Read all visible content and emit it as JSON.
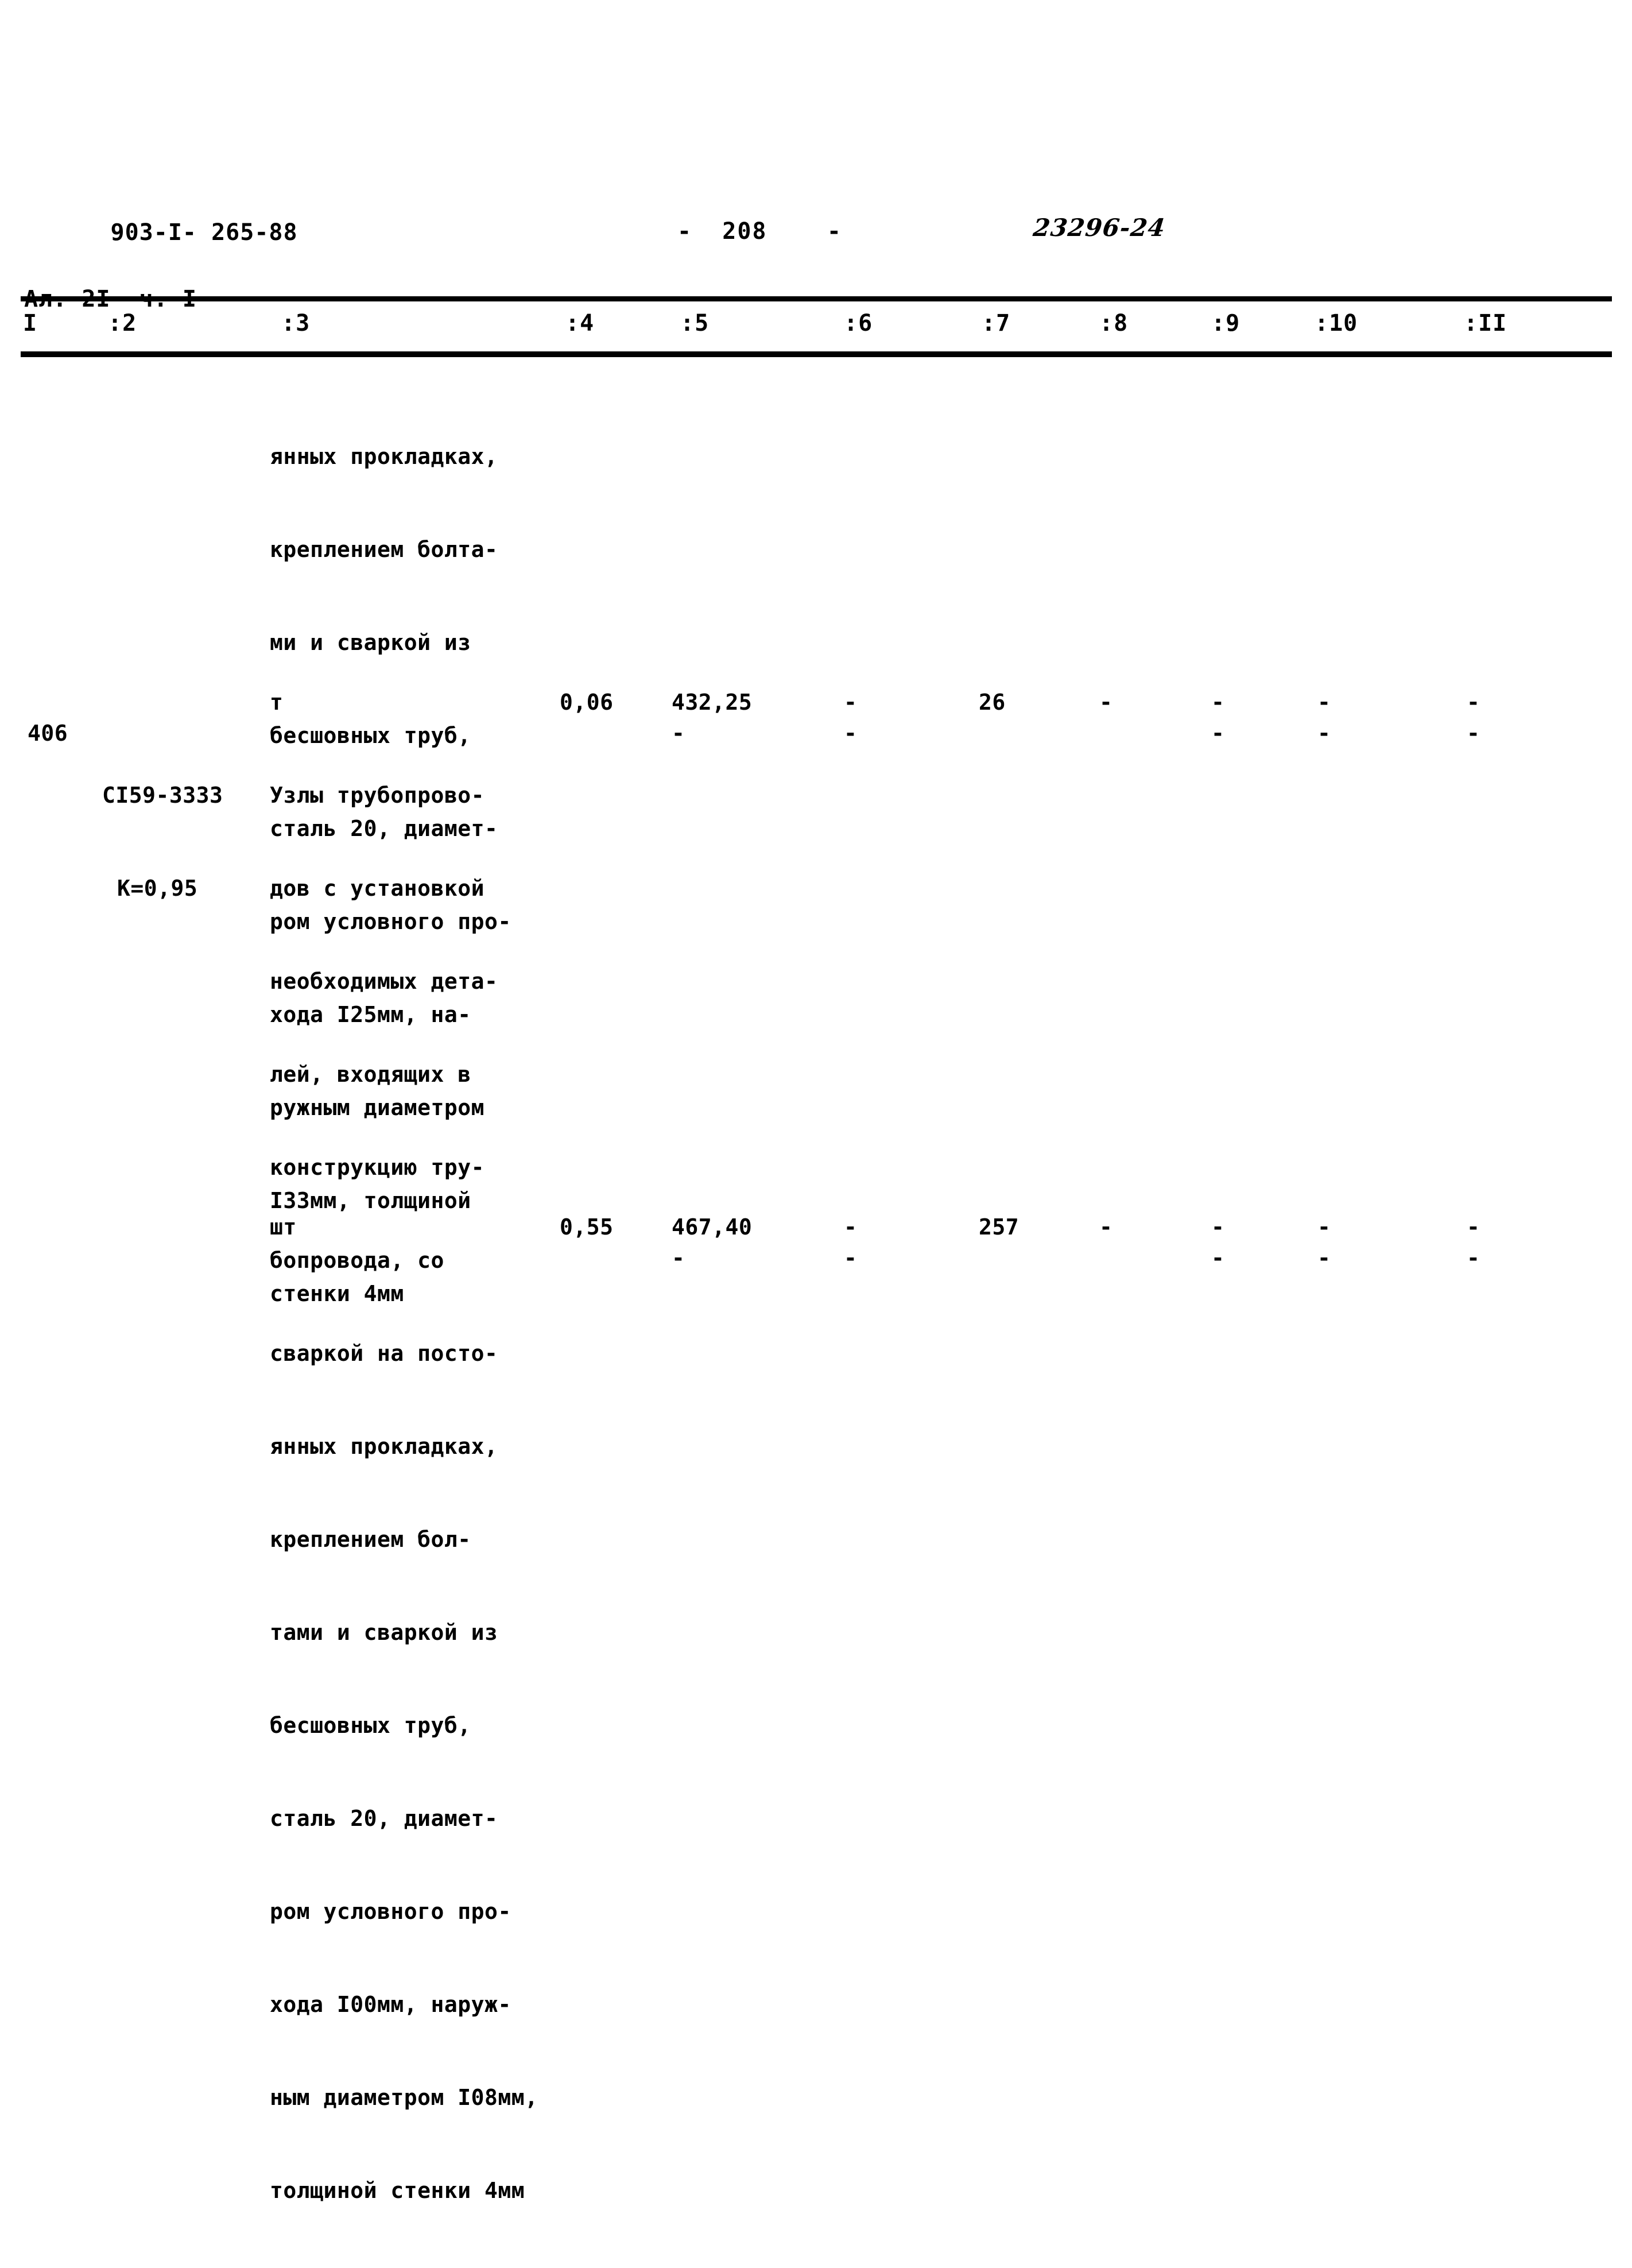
{
  "header": {
    "doc_id_line1": "903-I- 265-88",
    "doc_id_line2": "Ал. 2I  ч. I",
    "page_number": "-  208    -",
    "sheet_code": "23296-24"
  },
  "table": {
    "column_headers": [
      "I",
      ":2",
      ":3",
      ":4",
      ":5",
      ":6",
      ":7",
      ":8",
      ":9",
      ":10",
      ":II"
    ],
    "rows": [
      {
        "num": "",
        "code": "",
        "code2": "",
        "description_lines": [
          "янных прокладках,",
          "креплением болта-",
          "ми и сваркой из",
          "бесшовных труб,",
          "сталь 20, диамет-",
          "ром условного про-",
          "хода I25мм, на-",
          "ружным диаметром",
          "I33мм, толщиной",
          "стенки 4мм"
        ],
        "unit": "т",
        "c4": "0,06",
        "c5": "432,25",
        "c5b": "-",
        "c6": "-",
        "c6b": "-",
        "c7": "26",
        "c8": "-",
        "c9": "-",
        "c9b": "-",
        "c10": "-",
        "c10b": "-",
        "c11": "-",
        "c11b": "-"
      },
      {
        "num": "406",
        "code": "СI59-3333",
        "code2": "К=0,95",
        "description_lines": [
          "Узлы трубопрово-",
          "дов с установкой",
          "необходимых дета-",
          "лей, входящих в",
          "конструкцию тру-",
          "бопровода, со",
          "сваркой на посто-",
          "янных прокладках,",
          "креплением бол-",
          "тами и сваркой из",
          "бесшовных труб,",
          "сталь 20, диамет-",
          "ром условного про-",
          "хода I00мм, наруж-",
          "ным диаметром I08мм,",
          "толщиной стенки 4мм"
        ],
        "unit": "шт",
        "c4": "0,55",
        "c5": "467,40",
        "c5b": "-",
        "c6": "-",
        "c6b": "-",
        "c7": "257",
        "c8": "-",
        "c9": "-",
        "c9b": "-",
        "c10": "-",
        "c10b": "-",
        "c11": "-",
        "c11b": "-"
      }
    ]
  }
}
